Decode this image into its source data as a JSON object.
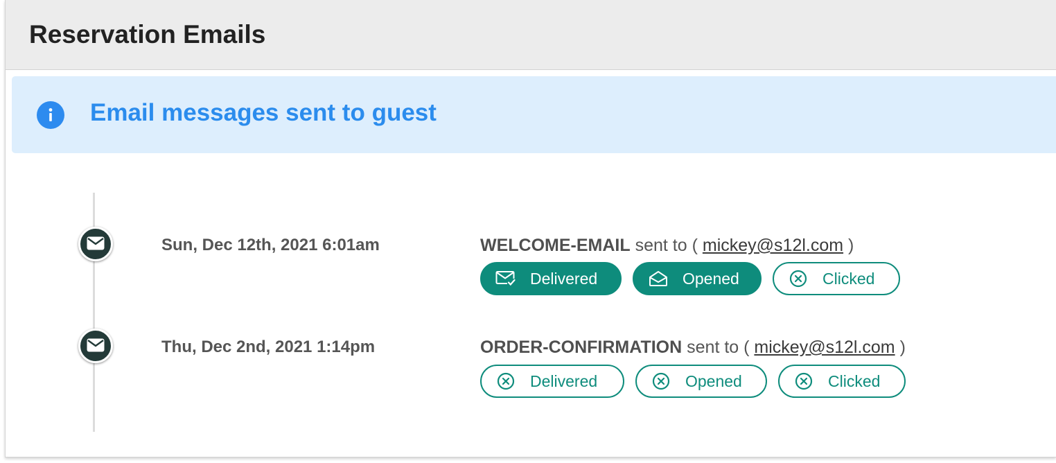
{
  "panel": {
    "title": "Reservation Emails"
  },
  "banner": {
    "icon": "info-icon",
    "text": "Email messages sent to guest"
  },
  "emails": [
    {
      "date": "Sun, Dec 12th, 2021 6:01am",
      "template": "WELCOME-EMAIL",
      "sent_to_prefix": "sent to (",
      "recipient": "mickey@s12l.com",
      "sent_to_suffix": ")",
      "statuses": [
        {
          "label": "Delivered",
          "state": "yes",
          "icon": "envelope-check-icon"
        },
        {
          "label": "Opened",
          "state": "yes",
          "icon": "envelope-open-icon"
        },
        {
          "label": "Clicked",
          "state": "no",
          "icon": "circle-x-icon"
        }
      ]
    },
    {
      "date": "Thu, Dec 2nd, 2021 1:14pm",
      "template": "ORDER-CONFIRMATION",
      "sent_to_prefix": "sent to (",
      "recipient": "mickey@s12l.com",
      "sent_to_suffix": ")",
      "statuses": [
        {
          "label": "Delivered",
          "state": "no",
          "icon": "circle-x-icon"
        },
        {
          "label": "Opened",
          "state": "no",
          "icon": "circle-x-icon"
        },
        {
          "label": "Clicked",
          "state": "no",
          "icon": "circle-x-icon"
        }
      ]
    }
  ],
  "colors": {
    "accent": "#0e8c7c",
    "info": "#2b8ced",
    "banner_bg": "#ddeefd",
    "header_bg": "#ececec",
    "timeline_dot": "#233a38"
  }
}
